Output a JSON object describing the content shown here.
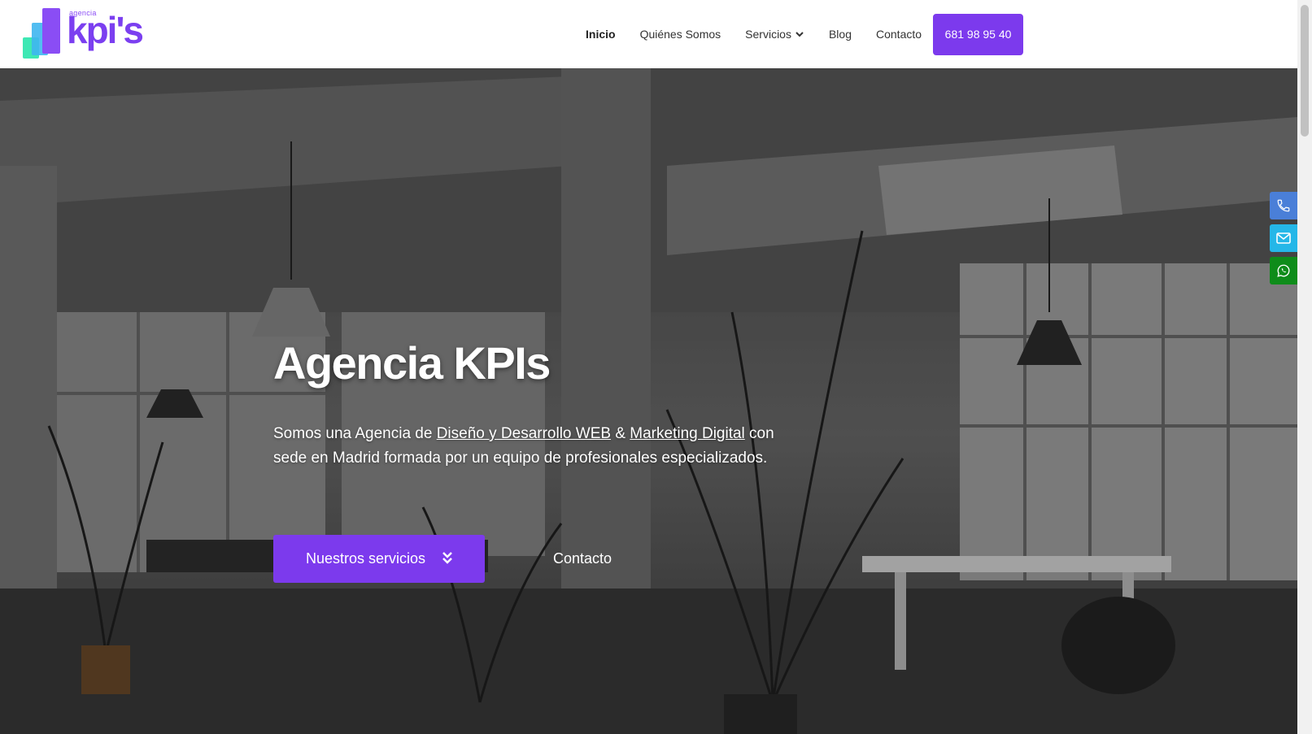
{
  "logo": {
    "small_text": "agencia",
    "big_text": "kpi's"
  },
  "nav": {
    "items": [
      {
        "label": "Inicio"
      },
      {
        "label": "Quiénes Somos"
      },
      {
        "label": "Servicios"
      },
      {
        "label": "Blog"
      },
      {
        "label": "Contacto"
      }
    ],
    "phone_button": "681 98 95 40"
  },
  "hero": {
    "title": "Agencia KPIs",
    "text_part1": "Somos una Agencia de ",
    "link1": "Diseño y Desarrollo WEB",
    "text_part2": " & ",
    "link2": "Marketing Digital",
    "text_part3": " con sede en Madrid formada por un equipo de profesionales especializados.",
    "primary_button": "Nuestros servicios",
    "secondary_button": "Contacto"
  },
  "side_buttons": [
    {
      "icon": "phone-icon",
      "color": "#4a7fd8"
    },
    {
      "icon": "mail-icon",
      "color": "#25b7e8"
    },
    {
      "icon": "whatsapp-icon",
      "color": "#0e8c1a"
    }
  ],
  "colors": {
    "accent": "#7c3aed"
  }
}
